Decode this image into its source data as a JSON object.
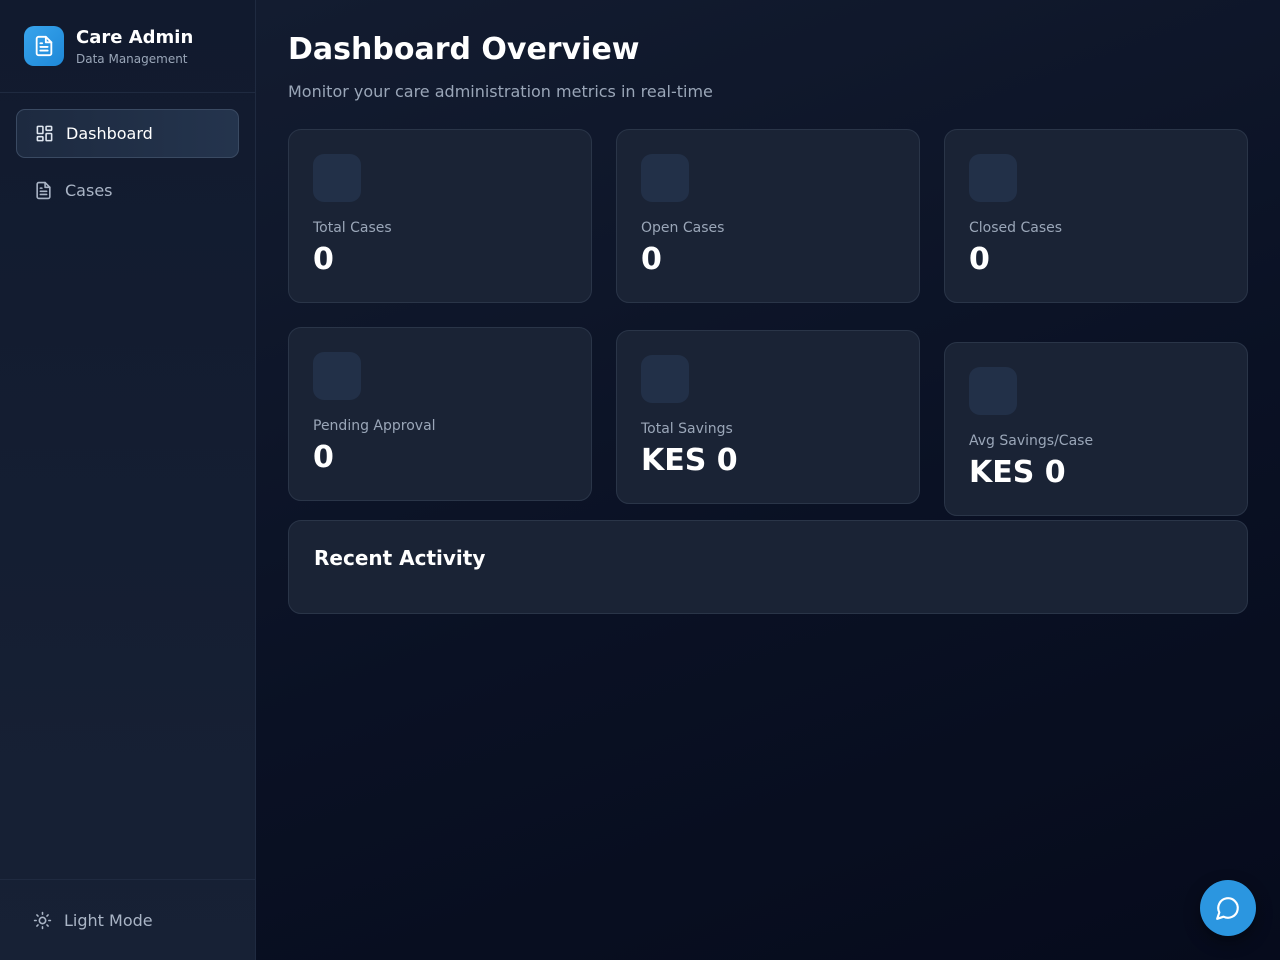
{
  "brand": {
    "title": "Care Admin",
    "subtitle": "Data Management",
    "icon": "document-icon",
    "accent": "#2b96e0"
  },
  "sidebar": {
    "items": [
      {
        "label": "Dashboard",
        "icon": "grid-icon",
        "active": true
      },
      {
        "label": "Cases",
        "icon": "document-icon",
        "active": false
      }
    ],
    "footer_label": "Light Mode",
    "footer_icon": "sun-icon"
  },
  "page": {
    "title": "Dashboard Overview",
    "subtitle": "Monitor your care administration metrics in real-time"
  },
  "stats": [
    {
      "label": "Total Cases",
      "value": "0"
    },
    {
      "label": "Open Cases",
      "value": "0"
    },
    {
      "label": "Closed Cases",
      "value": "0"
    },
    {
      "label": "Pending Approval",
      "value": "0"
    },
    {
      "label": "Total Savings",
      "value": "KES 0"
    },
    {
      "label": "Avg Savings/Case",
      "value": "KES 0"
    }
  ],
  "activity": {
    "title": "Recent Activity"
  },
  "chat": {
    "icon": "chat-bubble-icon"
  }
}
